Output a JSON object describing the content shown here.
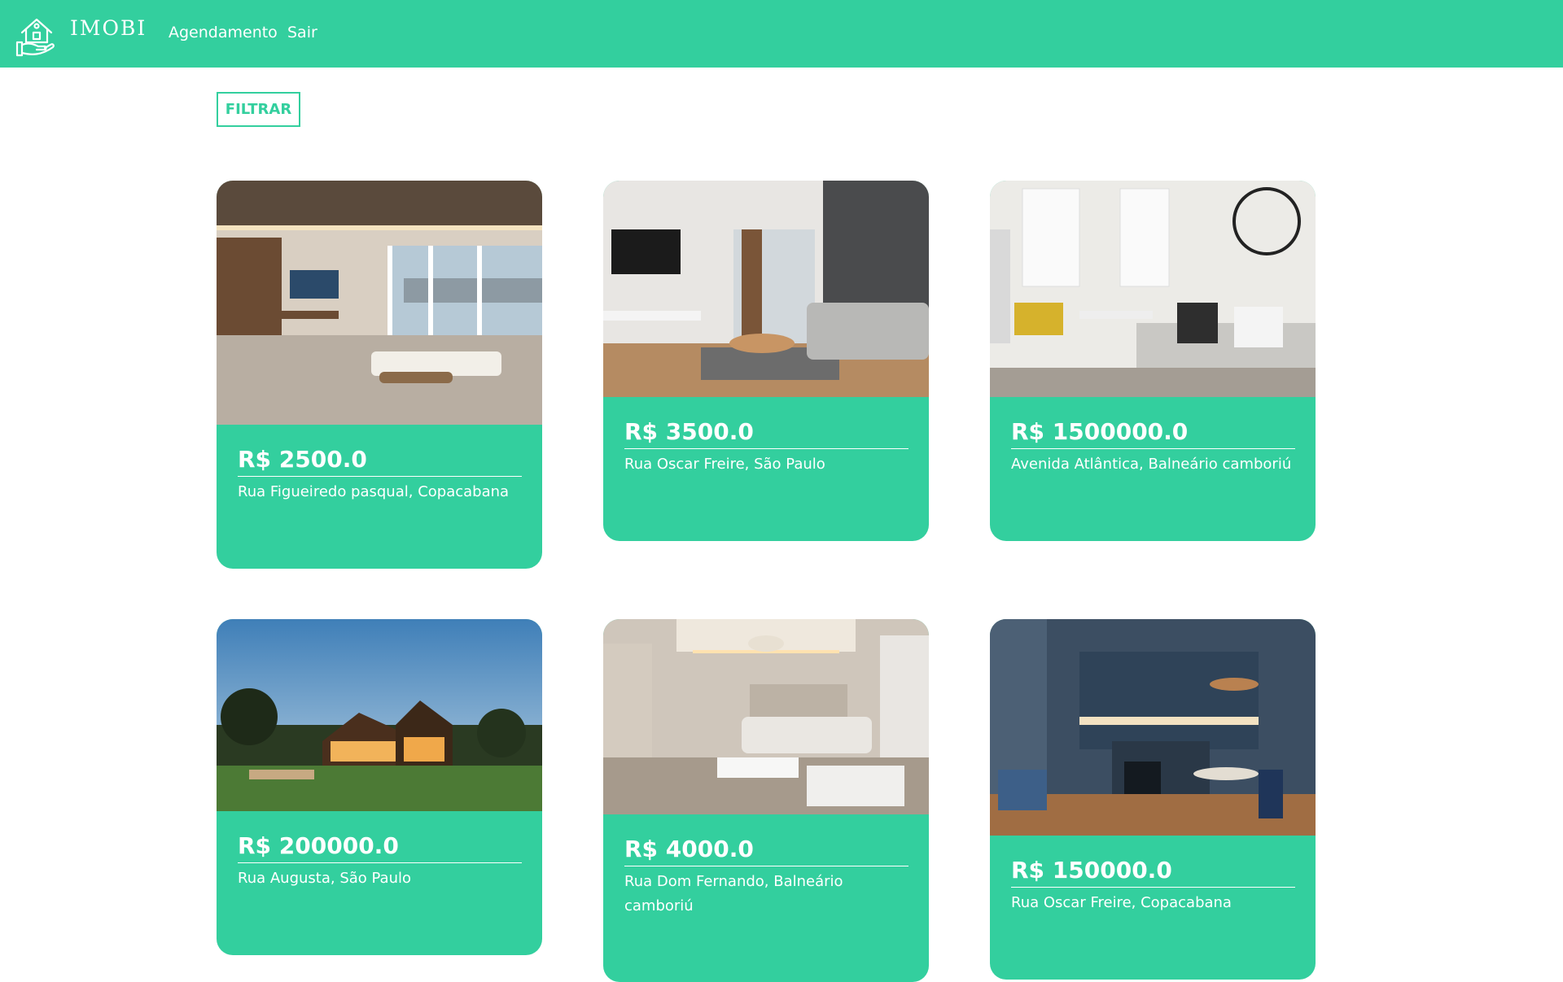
{
  "header": {
    "brand": "IMOBI",
    "nav": [
      {
        "label": "Agendamento"
      },
      {
        "label": "Sair"
      }
    ],
    "brand_color": "#33cf9e"
  },
  "filter": {
    "label": "FILTRAR"
  },
  "listings": [
    {
      "price": "R$ 2500.0",
      "address": "Rua Figueiredo pasqual, Copacabana",
      "image": "living-room-interior"
    },
    {
      "price": "R$ 3500.0",
      "address": "Rua Oscar Freire, São Paulo",
      "image": "living-room-interior"
    },
    {
      "price": "R$ 1500000.0",
      "address": "Avenida Atlântica, Balneário camboriú",
      "image": "living-room-interior"
    },
    {
      "price": "R$ 200000.0",
      "address": "Rua Augusta, São Paulo",
      "image": "house-exterior-dusk"
    },
    {
      "price": "R$ 4000.0",
      "address": "Rua Dom Fernando, Balneário camboriú",
      "image": "living-room-interior"
    },
    {
      "price": "R$ 150000.0",
      "address": "Rua Oscar Freire, Copacabana",
      "image": "kitchen-interior"
    }
  ]
}
